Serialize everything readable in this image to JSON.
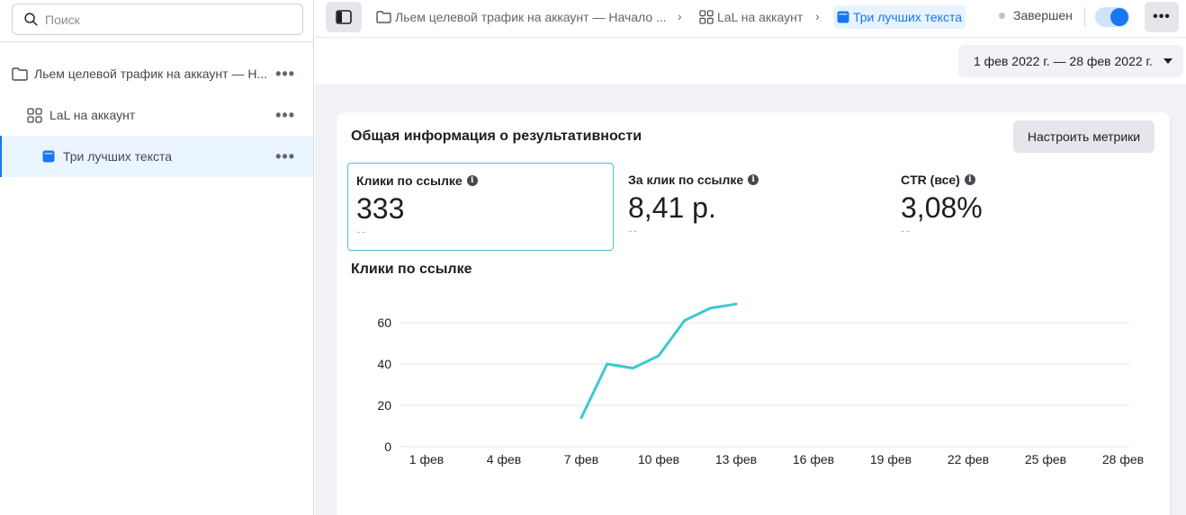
{
  "sidebar": {
    "search_placeholder": "Поиск",
    "items": [
      {
        "label": "Льем целевой трафик на аккаунт — Н...",
        "icon": "folder-icon"
      },
      {
        "label": "LaL на аккаунт",
        "icon": "grid-icon"
      },
      {
        "label": "Три лучших текста",
        "icon": "ad-icon"
      }
    ]
  },
  "topbar": {
    "breadcrumbs": [
      {
        "label": "Льем целевой трафик на аккаунт — Начало ...",
        "icon": "folder-icon"
      },
      {
        "label": "LaL на аккаунт",
        "icon": "grid-icon"
      },
      {
        "label": "Три лучших текста",
        "icon": "ad-icon"
      }
    ],
    "status": "Завершен"
  },
  "date_range": "1 фев 2022 г. — 28 фев 2022 г.",
  "card": {
    "title": "Общая информация о результативности",
    "metrics_button": "Настроить метрики",
    "kpis": [
      {
        "label": "Клики по ссылке",
        "value": "333",
        "delta": "--"
      },
      {
        "label": "За клик по ссылке",
        "value": "8,41 р.",
        "delta": "--"
      },
      {
        "label": "CTR (все)",
        "value": "3,08%",
        "delta": "--"
      }
    ],
    "chart_title": "Клики по ссылке"
  },
  "colors": {
    "accent": "#1877f2",
    "series": "#3ec8d0"
  },
  "chart_data": {
    "type": "line",
    "title": "Клики по ссылке",
    "x_ticks": [
      "1 фев",
      "4 фев",
      "7 фев",
      "10 фев",
      "13 фев",
      "16 фев",
      "19 фев",
      "22 фев",
      "25 фев",
      "28 фев"
    ],
    "y_ticks": [
      0,
      20,
      40,
      60
    ],
    "ylim": [
      0,
      60
    ],
    "xlim": [
      1,
      28
    ],
    "grid": true,
    "series": [
      {
        "x": [
          7,
          8,
          9,
          10,
          11,
          12,
          13
        ],
        "values": [
          14,
          40,
          38,
          44,
          61,
          67,
          69
        ]
      }
    ]
  }
}
